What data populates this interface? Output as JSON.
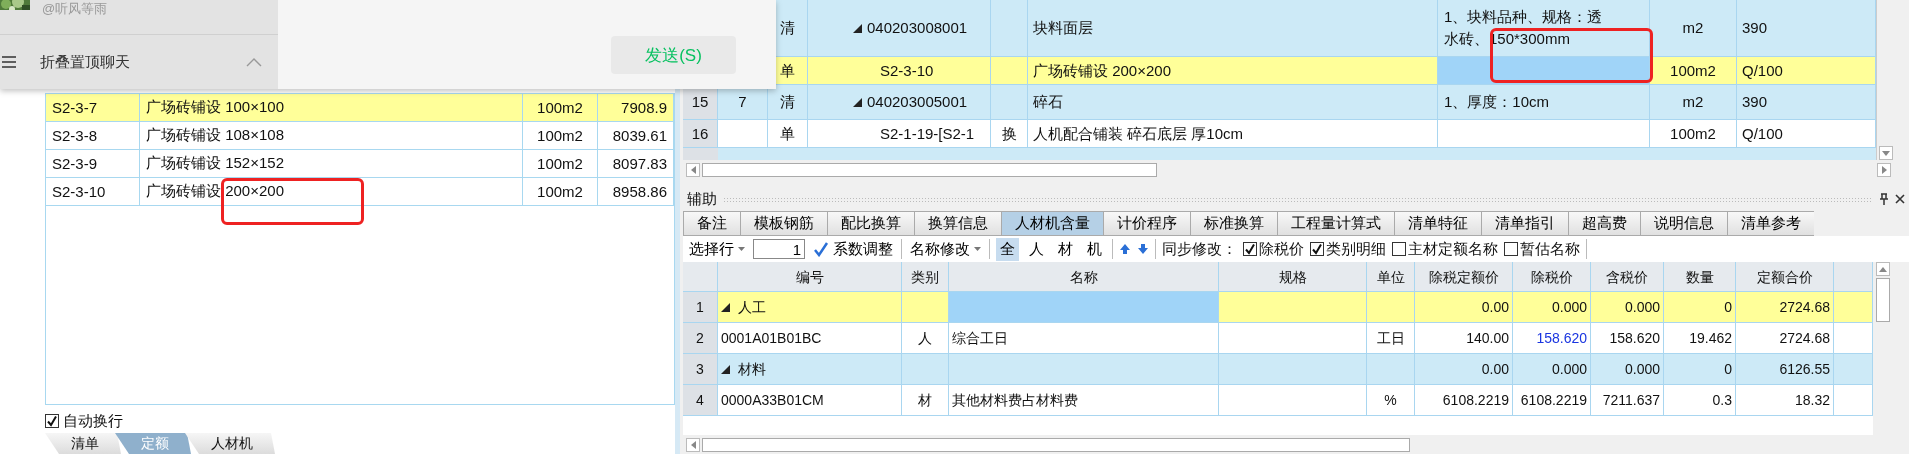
{
  "chat_popup": {
    "handle": "@听风等雨",
    "collapse_label": "折叠置顶聊天",
    "send_button": "发送(S)"
  },
  "left_list": {
    "rows": [
      {
        "code": "S2-3-7",
        "name": "广场砖铺设 100×100",
        "unit": "100m2",
        "price": "7908.9",
        "selected": true
      },
      {
        "code": "S2-3-8",
        "name": "广场砖铺设 108×108",
        "unit": "100m2",
        "price": "8039.61",
        "selected": false
      },
      {
        "code": "S2-3-9",
        "name": "广场砖铺设 152×152",
        "unit": "100m2",
        "price": "8097.83",
        "selected": false
      },
      {
        "code": "S2-3-10",
        "name": "广场砖铺设 200×200",
        "unit": "100m2",
        "price": "8958.86",
        "selected": false
      }
    ],
    "auto_wrap": {
      "label": "自动换行",
      "checked": true
    },
    "bottom_tabs": [
      {
        "label": "清单",
        "selected": false
      },
      {
        "label": "定额",
        "selected": true
      },
      {
        "label": "人材机",
        "selected": false
      }
    ]
  },
  "bill_grid": {
    "rows": [
      {
        "kind": "bill",
        "type": "清",
        "code": "040203008001",
        "name": "块料面层",
        "spec": "1、块料品种、规格：透水砖、150*300mm",
        "unit": "m2",
        "quantity": "390",
        "selected": false
      },
      {
        "kind": "quota",
        "type": "单",
        "code": "S2-3-10",
        "name": "广场砖铺设 200×200",
        "unit": "100m2",
        "quantity": "Q/100",
        "selected": true
      },
      {
        "kind": "bill",
        "row_number": "15",
        "seq": "7",
        "type": "清",
        "code": "040203005001",
        "name": "碎石",
        "spec": "1、厚度：10cm",
        "unit": "m2",
        "quantity": "390",
        "selected": false
      },
      {
        "kind": "quota",
        "row_number": "16",
        "type": "单",
        "code": "S2-1-19-[S2-1",
        "conversion": "换",
        "name": "人机配合铺装 碎石底层 厚10cm",
        "unit": "100m2",
        "quantity": "Q/100",
        "selected": false
      }
    ]
  },
  "aux_panel": {
    "title": "辅助",
    "tabs": [
      {
        "label": "备注",
        "selected": false
      },
      {
        "label": "模板钢筋",
        "selected": false
      },
      {
        "label": "配比换算",
        "selected": false
      },
      {
        "label": "换算信息",
        "selected": false
      },
      {
        "label": "人材机含量",
        "selected": true
      },
      {
        "label": "计价程序",
        "selected": false
      },
      {
        "label": "标准换算",
        "selected": false
      },
      {
        "label": "工程量计算式",
        "selected": false
      },
      {
        "label": "清单特征",
        "selected": false
      },
      {
        "label": "清单指引",
        "selected": false
      },
      {
        "label": "超高费",
        "selected": false
      },
      {
        "label": "说明信息",
        "selected": false
      },
      {
        "label": "清单参考",
        "selected": false
      }
    ],
    "toolbar": {
      "select_row": "选择行",
      "row_value": "1",
      "coef_button": "系数调整",
      "rename_button": "名称修改",
      "filters": [
        {
          "label": "全",
          "selected": true
        },
        {
          "label": "人",
          "selected": false
        },
        {
          "label": "材",
          "selected": false
        },
        {
          "label": "机",
          "selected": false
        }
      ],
      "sync_label": "同步修改：",
      "sync_options": [
        {
          "label": "除税价",
          "checked": true
        },
        {
          "label": "类别明细",
          "checked": true
        },
        {
          "label": "主材定额名称",
          "checked": false
        },
        {
          "label": "暂估名称",
          "checked": false
        }
      ]
    },
    "grid": {
      "columns": [
        "编号",
        "类别",
        "名称",
        "规格",
        "单位",
        "除税定额价",
        "除税价",
        "含税价",
        "数量",
        "定额合价"
      ],
      "rows": [
        {
          "row_number": "1",
          "kind": "group",
          "code": "人工",
          "base_price": "0.00",
          "price": "0.000",
          "price_with_tax": "0.000",
          "quantity": "0",
          "amount": "2724.68",
          "selected": true,
          "price_changed": false
        },
        {
          "row_number": "2",
          "kind": "item",
          "code": "0001A01B01BC",
          "category": "人",
          "name": "综合工日",
          "unit": "工日",
          "base_price": "140.00",
          "price": "158.620",
          "price_with_tax": "158.620",
          "quantity": "19.462",
          "amount": "2724.68",
          "selected": false,
          "price_changed": true
        },
        {
          "row_number": "3",
          "kind": "group",
          "code": "材料",
          "base_price": "0.00",
          "price": "0.000",
          "price_with_tax": "0.000",
          "quantity": "0",
          "amount": "6126.55",
          "selected": false,
          "price_changed": false
        },
        {
          "row_number": "4",
          "kind": "item",
          "code": "0000A33B01CM",
          "category": "材",
          "name": "其他材料费占材料费",
          "unit": "%",
          "base_price": "6108.2219",
          "price": "6108.2219",
          "price_with_tax": "7211.637",
          "quantity": "0.3",
          "amount": "18.32",
          "selected": false,
          "price_changed": false
        }
      ]
    }
  }
}
